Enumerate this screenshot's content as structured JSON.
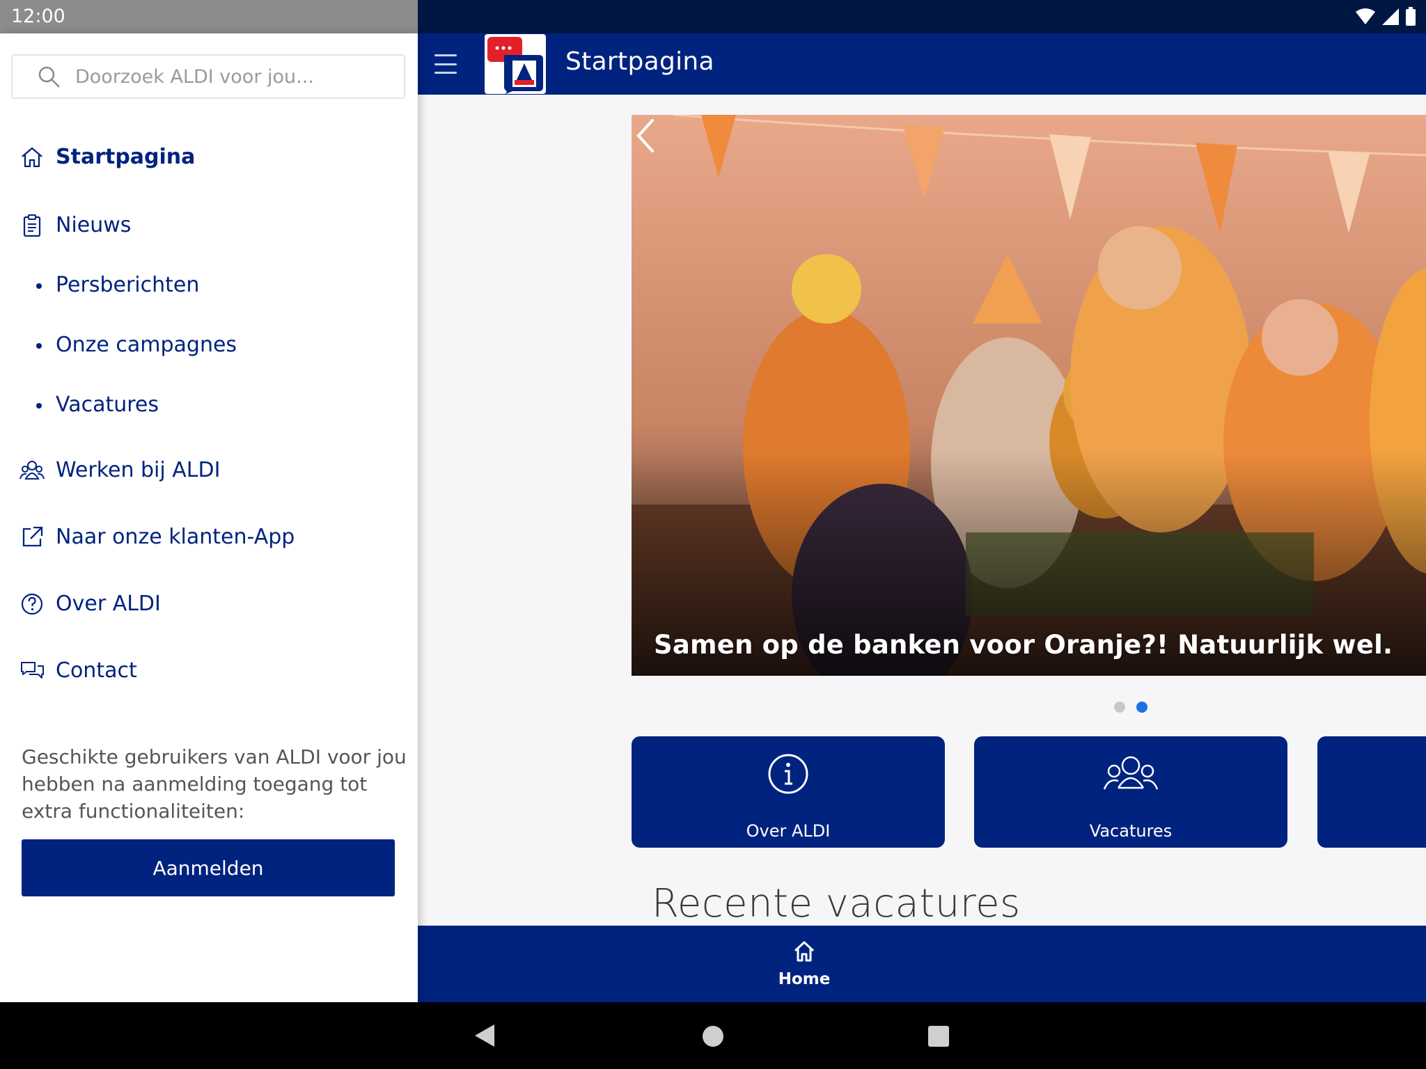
{
  "status_bar": {
    "time": "12:00"
  },
  "app_bar": {
    "title": "Startpagina"
  },
  "drawer": {
    "search_placeholder": "Doorzoek ALDI voor jou...",
    "items": [
      {
        "label": "Startpagina",
        "icon": "home-icon",
        "active": true
      },
      {
        "label": "Nieuws",
        "icon": "clipboard-icon"
      },
      {
        "label": "Persberichten",
        "sub": true
      },
      {
        "label": "Onze campagnes",
        "sub": true
      },
      {
        "label": "Vacatures",
        "sub": true
      },
      {
        "label": "Werken bij ALDI",
        "icon": "people-icon"
      },
      {
        "label": "Naar onze klanten-App",
        "icon": "external-link-icon"
      },
      {
        "label": "Over ALDI",
        "icon": "question-icon"
      },
      {
        "label": "Contact",
        "icon": "chat-icon"
      }
    ],
    "login_text": "Geschikte gebruikers van ALDI voor jou hebben na aanmelding toegang tot extra functionaliteiten:",
    "login_button": "Aanmelden"
  },
  "carousel": {
    "caption": "Samen op de banken voor Oranje?! Natuurlijk wel.",
    "slides": 2,
    "active_slide": 2
  },
  "tiles": [
    {
      "label": "Over ALDI",
      "icon": "info-icon"
    },
    {
      "label": "Vacatures",
      "icon": "team-icon"
    }
  ],
  "section_title": "Recente vacatures",
  "bottom_nav": {
    "home_label": "Home"
  },
  "colors": {
    "brand_blue": "#00237f",
    "status_dark": "#001744",
    "dot_active": "#1e70e8"
  }
}
